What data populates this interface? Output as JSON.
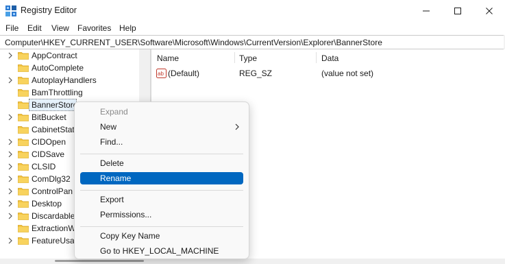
{
  "window": {
    "title": "Registry Editor",
    "controls": [
      "minimize-icon",
      "maximize-icon",
      "close-icon"
    ]
  },
  "menubar": {
    "items": [
      "File",
      "Edit",
      "View",
      "Favorites",
      "Help"
    ]
  },
  "address": {
    "path": "Computer\\HKEY_CURRENT_USER\\Software\\Microsoft\\Windows\\CurrentVersion\\Explorer\\BannerStore"
  },
  "tree": {
    "items": [
      {
        "label": "AppContract",
        "expandable": true
      },
      {
        "label": "AutoComplete",
        "expandable": false
      },
      {
        "label": "AutoplayHandlers",
        "expandable": true
      },
      {
        "label": "BamThrottling",
        "expandable": false
      },
      {
        "label": "BannerStore",
        "expandable": false,
        "selected": true
      },
      {
        "label": "BitBucket",
        "expandable": true
      },
      {
        "label": "CabinetStat",
        "expandable": false
      },
      {
        "label": "CIDOpen",
        "expandable": true
      },
      {
        "label": "CIDSave",
        "expandable": true
      },
      {
        "label": "CLSID",
        "expandable": true
      },
      {
        "label": "ComDlg32",
        "expandable": true
      },
      {
        "label": "ControlPan",
        "expandable": true
      },
      {
        "label": "Desktop",
        "expandable": true
      },
      {
        "label": "Discardable",
        "expandable": true
      },
      {
        "label": "ExtractionW",
        "expandable": false
      },
      {
        "label": "FeatureUsag",
        "expandable": true
      }
    ]
  },
  "values_pane": {
    "columns": [
      "Name",
      "Type",
      "Data"
    ],
    "rows": [
      {
        "icon": "string-value-icon",
        "name": "(Default)",
        "type": "REG_SZ",
        "data": "(value not set)"
      }
    ]
  },
  "context_menu": {
    "items": [
      {
        "label": "Expand",
        "disabled": true
      },
      {
        "label": "New",
        "submenu": true
      },
      {
        "label": "Find..."
      },
      {
        "separator": true
      },
      {
        "label": "Delete"
      },
      {
        "label": "Rename",
        "highlighted": true
      },
      {
        "separator": true
      },
      {
        "label": "Export"
      },
      {
        "label": "Permissions..."
      },
      {
        "separator": true
      },
      {
        "label": "Copy Key Name"
      },
      {
        "label": "Go to HKEY_LOCAL_MACHINE"
      }
    ]
  },
  "colors": {
    "accent": "#0067c0",
    "folder": "#f4c542",
    "selection": "#e5f1fb"
  }
}
